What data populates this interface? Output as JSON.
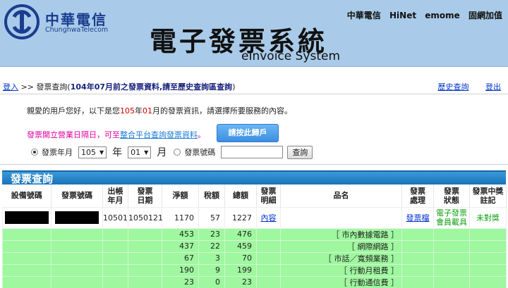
{
  "header": {
    "logo_cn": "中華電信",
    "logo_en": "ChunghwaTelecom",
    "brand_links": [
      "中華電信",
      "HiNet",
      "emome",
      "固網加值"
    ],
    "system_title": "電子發票系統",
    "system_subtitle": "eInvoice System"
  },
  "breadcrumb": {
    "login": "登入",
    "sep": ">>",
    "current": "發票查詢(",
    "notice": "104年07月前之發票資料,請至歷史查詢區查詢",
    "close": ")"
  },
  "toplinks": {
    "history": "歷史查詢",
    "logout": "登出"
  },
  "greeting": {
    "prefix": "親愛的用戶您好，以下是您",
    "year": "105",
    "year_suffix": "年",
    "month": "01",
    "suffix": "月的發票資訊，請選擇所要服務的內容。"
  },
  "note": {
    "prefix": "發票開立營業日隔日，可至",
    "link": "整合平台查詢發票資料",
    "suffix": "。"
  },
  "bind_button": "請按此歸戶",
  "query": {
    "opt1": "發票年月",
    "year": "105",
    "year_unit": "年",
    "month": "01",
    "month_unit": "月",
    "opt2": "發票號碼",
    "invoice_value": "",
    "submit": "查詢"
  },
  "section_title": "發票查詢",
  "table": {
    "headers": [
      "設備號碼",
      "發票號碼",
      "出帳\n年月",
      "發票\n日期",
      "淨額",
      "稅額",
      "總額",
      "發票\n明細",
      "品名",
      "發票\n處理",
      "發票\n狀態",
      "發票中獎\n註記"
    ],
    "main_row": {
      "month": "10501",
      "date": "1050121",
      "net": "1170",
      "tax": "57",
      "total": "1227",
      "detail": "內容",
      "action": "發票檔",
      "status": "電子發票\n會員載具",
      "prize": "未對獎"
    },
    "items": [
      {
        "net": "453",
        "tax": "23",
        "total": "476",
        "name": "［ 市內數據電路 ］"
      },
      {
        "net": "437",
        "tax": "22",
        "total": "459",
        "name": "［ 網際網路 ］"
      },
      {
        "net": "67",
        "tax": "3",
        "total": "70",
        "name": "［ 市話／寬頻業務 ］"
      },
      {
        "net": "190",
        "tax": "9",
        "total": "199",
        "name": "［ 行動月租費 ］"
      },
      {
        "net": "23",
        "tax": "0",
        "total": "23",
        "name": "［ 行動通信費 ］"
      }
    ]
  },
  "colors": {
    "header_bg": "#a9cbe9",
    "section_bar": "#1872b8",
    "item_row": "#9ff79f",
    "note": "#e000a0"
  }
}
